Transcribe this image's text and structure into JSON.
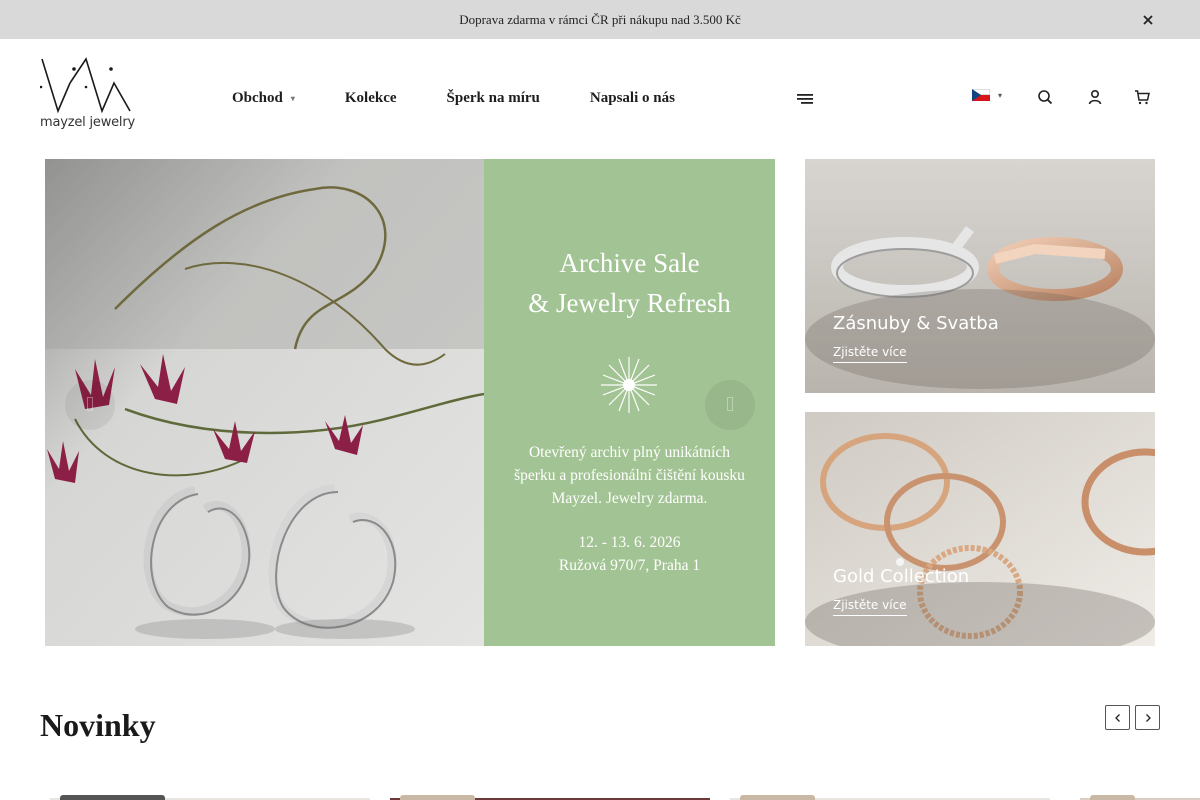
{
  "announcement": {
    "text": "Doprava zdarma v rámci ČR při nákupu nad 3.500 Kč",
    "close_icon": "close-icon"
  },
  "header": {
    "logo_text": "mayzel jewelry",
    "nav": [
      {
        "label": "Obchod",
        "has_dropdown": true
      },
      {
        "label": "Kolekce",
        "has_dropdown": false
      },
      {
        "label": "Šperk na míru",
        "has_dropdown": false
      },
      {
        "label": "Napsali o nás",
        "has_dropdown": false
      }
    ],
    "icons": [
      "menu-icon",
      "search-icon",
      "user-icon",
      "cart-icon"
    ],
    "language": "cz-flag"
  },
  "hero": {
    "title": "Archive Sale\n& Jewelry Refresh",
    "description": "Otevřený archiv plný unikátních\nšperku a profesionální čištění kousku\nMayzel. Jewelry zdarma.",
    "dates": "12. - 13. 6. 2026\nRužová 970/7, Praha 1",
    "panel_color": "#a2c393"
  },
  "banners": [
    {
      "title": "Zásnuby & Svatba",
      "link": "Zjistěte více"
    },
    {
      "title": "Gold Collection",
      "link": "Zjistěte více"
    }
  ],
  "novinky": {
    "title": "Novinky"
  }
}
